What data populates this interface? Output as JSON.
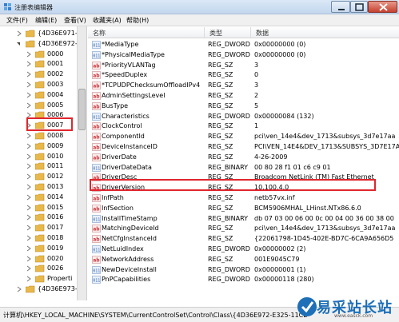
{
  "window": {
    "title": "注册表编辑器"
  },
  "menu": [
    "文件(F)",
    "编辑(E)",
    "查看(V)",
    "收藏夹(A)",
    "帮助(H)"
  ],
  "tree": {
    "items": [
      {
        "label": "{4D36E971-",
        "expander": "plus"
      },
      {
        "label": "{4D36E972-",
        "expander": "minus"
      },
      {
        "label": "0000",
        "expander": "plus"
      },
      {
        "label": "0001",
        "expander": "plus"
      },
      {
        "label": "0002",
        "expander": "plus"
      },
      {
        "label": "0003",
        "expander": "plus"
      },
      {
        "label": "0004",
        "expander": "plus"
      },
      {
        "label": "0005",
        "expander": "plus"
      },
      {
        "label": "0006",
        "expander": "plus"
      },
      {
        "label": "0007",
        "expander": "plus"
      },
      {
        "label": "0008",
        "expander": "plus"
      },
      {
        "label": "0009",
        "expander": "plus"
      },
      {
        "label": "0010",
        "expander": "plus"
      },
      {
        "label": "0011",
        "expander": "plus"
      },
      {
        "label": "0012",
        "expander": "plus"
      },
      {
        "label": "0013",
        "expander": "plus"
      },
      {
        "label": "0014",
        "expander": "plus"
      },
      {
        "label": "0015",
        "expander": "plus"
      },
      {
        "label": "0016",
        "expander": "plus"
      },
      {
        "label": "0017",
        "expander": "plus"
      },
      {
        "label": "0018",
        "expander": "plus"
      },
      {
        "label": "0019",
        "expander": "plus"
      },
      {
        "label": "0020",
        "expander": "plus"
      },
      {
        "label": "0026",
        "expander": "plus"
      },
      {
        "label": "Properti",
        "expander": "plus"
      },
      {
        "label": "{4D36E973-",
        "expander": "plus"
      }
    ]
  },
  "columns": {
    "name": "名称",
    "type": "类型",
    "data": "数据"
  },
  "values": [
    {
      "name": "*MediaType",
      "type": "REG_DWORD",
      "data": "0x00000000 (0)"
    },
    {
      "name": "*PhysicalMediaType",
      "type": "REG_DWORD",
      "data": "0x00000000 (0)"
    },
    {
      "name": "*PriorityVLANTag",
      "type": "REG_SZ",
      "data": "3"
    },
    {
      "name": "*SpeedDuplex",
      "type": "REG_SZ",
      "data": "0"
    },
    {
      "name": "*TCPUDPChecksumOffloadIPv4",
      "type": "REG_SZ",
      "data": "3"
    },
    {
      "name": "AdminSettingsLevel",
      "type": "REG_SZ",
      "data": "2"
    },
    {
      "name": "BusType",
      "type": "REG_SZ",
      "data": "5"
    },
    {
      "name": "Characteristics",
      "type": "REG_DWORD",
      "data": "0x00000084 (132)"
    },
    {
      "name": "ClockControl",
      "type": "REG_SZ",
      "data": "1"
    },
    {
      "name": "ComponentId",
      "type": "REG_SZ",
      "data": "pci\\ven_14e4&dev_1713&subsys_3d7e17aa"
    },
    {
      "name": "DeviceInstanceID",
      "type": "REG_SZ",
      "data": "PCI\\VEN_14E4&DEV_1713&SUBSYS_3D7E17AA"
    },
    {
      "name": "DriverDate",
      "type": "REG_SZ",
      "data": "4-26-2009"
    },
    {
      "name": "DriverDateData",
      "type": "REG_BINARY",
      "data": "00 80 28 f1 01 c6 c9 01"
    },
    {
      "name": "DriverDesc",
      "type": "REG_SZ",
      "data": "Broadcom NetLink (TM) Fast Ethernet"
    },
    {
      "name": "DriverVersion",
      "type": "REG_SZ",
      "data": "10.100.4.0"
    },
    {
      "name": "InfPath",
      "type": "REG_SZ",
      "data": "netb57vx.inf"
    },
    {
      "name": "InfSection",
      "type": "REG_SZ",
      "data": "BCM5906MHAL_LHinst.NTx86.6.0"
    },
    {
      "name": "InstallTimeStamp",
      "type": "REG_BINARY",
      "data": "db 07 03 00 06 00 0c 00 04 00 36 00 38 00"
    },
    {
      "name": "MatchingDeviceId",
      "type": "REG_SZ",
      "data": "pci\\ven_14e4&dev_1713&subsys_3d7e17aa"
    },
    {
      "name": "NetCfgInstanceId",
      "type": "REG_SZ",
      "data": "{22061798-1D45-402E-BD7C-6CA9A656D5"
    },
    {
      "name": "NetLuidIndex",
      "type": "REG_DWORD",
      "data": "0x00000002 (2)"
    },
    {
      "name": "NetworkAddress",
      "type": "REG_SZ",
      "data": "001E9045C79"
    },
    {
      "name": "NewDeviceInstall",
      "type": "REG_DWORD",
      "data": "0x00000001 (1)"
    },
    {
      "name": "PnPCapabilities",
      "type": "REG_DWORD",
      "data": "0x00000118 (280)"
    }
  ],
  "status": {
    "path": "计算机\\HKEY_LOCAL_MACHINE\\SYSTEM\\CurrentControlSet\\Control\\Class\\{4D36E972-E325-11CE"
  },
  "watermark": {
    "text": "易采站长站",
    "url": "www.easck.com"
  },
  "colors": {
    "highlight": "#e0262e",
    "folder": "#e8b94a",
    "icon_ab": "#c8343a",
    "icon_bin": "#2d5fa8"
  }
}
